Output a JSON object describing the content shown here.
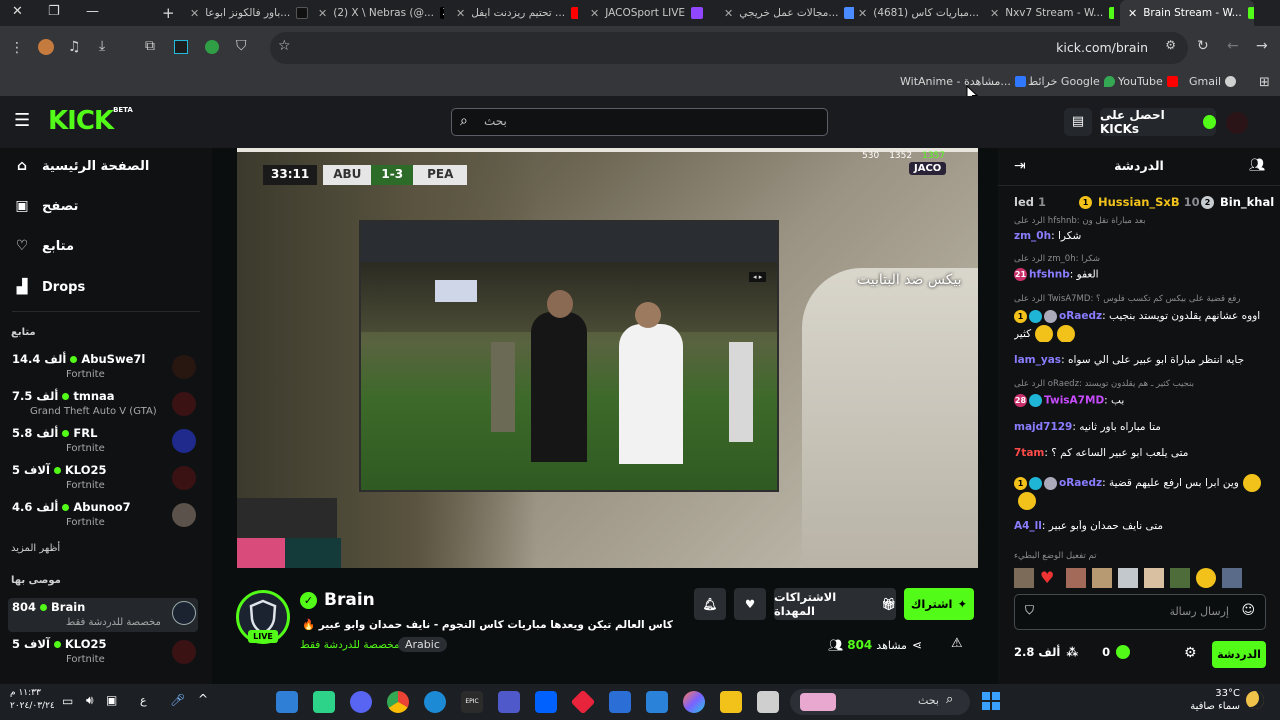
{
  "browser": {
    "tabs": [
      {
        "label": "باور فالكونز ابوعا...",
        "active": false
      },
      {
        "label": "(2) X \\ Nebras (@...",
        "active": false
      },
      {
        "label": "تحتيم ريزدنت ايفل ...",
        "active": false
      },
      {
        "label": "JACOSport LIVE",
        "active": false
      },
      {
        "label": "مجالات عمل خريجي...",
        "active": false
      },
      {
        "label": "(4681) مباريات كاس...",
        "active": false
      },
      {
        "label": "Nxv7 Stream - W...",
        "active": false
      },
      {
        "label": "Brain Stream - W...",
        "active": true
      }
    ],
    "url": "kick.com/brain",
    "bookmarks": [
      {
        "label": "WitAnime - مشاهدة...",
        "color": "#2f78ff"
      },
      {
        "label": "خرائط Google",
        "color": "#34a853"
      },
      {
        "label": "YouTube",
        "color": "#ff0000"
      },
      {
        "label": "Gmail",
        "color": "#d0d0d0"
      }
    ]
  },
  "kick": {
    "logo": "KICK",
    "logo_badge": "BETA",
    "search_placeholder": "بحث",
    "get_kicks": "احصل على KICKs",
    "brand_color": "#53fc18"
  },
  "sidebar": {
    "nav": [
      {
        "label": "الصفحة الرئيسية",
        "icon": "home-icon"
      },
      {
        "label": "تصفح",
        "icon": "browse-icon"
      },
      {
        "label": "متابع",
        "icon": "heart-icon"
      },
      {
        "label": "Drops",
        "icon": "drops-icon"
      }
    ],
    "following_title": "متابع",
    "following": [
      {
        "name": "AbuSwe7l",
        "viewers": "14.4 ألف",
        "game": "Fortnite"
      },
      {
        "name": "tmnaa",
        "viewers": "7.5 ألف",
        "game": "Grand Theft Auto V (GTA)"
      },
      {
        "name": "FRL",
        "viewers": "5.8 ألف",
        "game": "Fortnite"
      },
      {
        "name": "KLO25",
        "viewers": "5 آلاف",
        "game": "Fortnite"
      },
      {
        "name": "Abunoo7",
        "viewers": "4.6 ألف",
        "game": "Fortnite"
      }
    ],
    "show_more": "أظهر المزيد",
    "recommended_title": "موصى بها",
    "recommended": [
      {
        "name": "Brain",
        "viewers": "804",
        "game": "مخصصة للدردشة فقط"
      },
      {
        "name": "KLO25",
        "viewers": "5 آلاف",
        "game": "Fortnite"
      }
    ]
  },
  "video": {
    "score_time": "33:11",
    "team_home": "ABU",
    "score": "1-3",
    "team_away": "PEA",
    "viewers_a": "530",
    "viewers_b": "1352",
    "viewers_c": "1357",
    "sponsor": "JACO",
    "caption": "بيكس ضد البتابيت"
  },
  "stream": {
    "channel": "Brain",
    "live": "LIVE",
    "title": "كاس العالم تيكن ويعدها مباريات كاس النجوم - نايف حمدان وابو عبير 🔥",
    "category": "مخصصة للدردشة فقط",
    "language": "Arabic",
    "viewers_label": "مشاهد",
    "viewers": "804",
    "subscribe_label": "اشتراك",
    "gift_label": "الاشتراكات المهداة"
  },
  "chat": {
    "title": "الدردشة",
    "leaderboard": [
      {
        "name": "Bin_khal",
        "rank": "2"
      },
      {
        "name": "Hussian_SxB",
        "count": "10",
        "rank": "1"
      },
      {
        "name": "led",
        "count": "1"
      }
    ],
    "messages": [
      {
        "reply": "الرد على hfshnb: بعد مباراة تقل ون"
      },
      {
        "user": "zm_0h",
        "color": "#8a7dff",
        "text": "شكرا"
      },
      {
        "reply": "الرد على zm_0h: شكرا"
      },
      {
        "user": "hfshnb",
        "color": "#8a7dff",
        "text": "العفو"
      },
      {
        "reply": "الرد على TwisA7MD: رفع قضية على بيكس كم تكسب فلوس ؟"
      },
      {
        "user": "oRaedz",
        "color": "#8a7dff",
        "text": "اووه عشانهم يقلدون تويستد بنجيب كثير"
      },
      {
        "user": "lam_yas",
        "color": "#8a7dff",
        "text": "جايه انتظر مباراة ابو عبير على الي سواه"
      },
      {
        "reply": "الرد على oRaedz: بنجيب كثير ـ هم يقلدون تويستد"
      },
      {
        "user": "TwisA7MD",
        "color": "#c94cff",
        "text": "بب"
      },
      {
        "user": "majd7129",
        "color": "#8a7dff",
        "text": "متا مباراه باور ثانيه"
      },
      {
        "user": "7tam",
        "color": "#ff4a4a",
        "text": "متى يلعب ابو عبير الساعه كم ؟"
      },
      {
        "user": "oRaedz",
        "color": "#8a7dff",
        "text": "وين ابرا بس ارفع عليهم قضية"
      },
      {
        "user": "A4_ll",
        "color": "#8a7dff",
        "text": "متى نايف حمدان وأبو عبير"
      },
      {
        "reply": "تم تفعيل الوضع البطيء"
      }
    ],
    "input_placeholder": "إرسال رسالة",
    "send_label": "الدردشة",
    "kicks_count": "0",
    "followers_count": "2.8 ألف"
  },
  "taskbar": {
    "search_placeholder": "بحث",
    "weather_temp": "33°C",
    "weather_text": "سماء صافية",
    "time": "١١:٣٣ م",
    "date": "٢٠٢٤/٠٣/٢٤"
  }
}
